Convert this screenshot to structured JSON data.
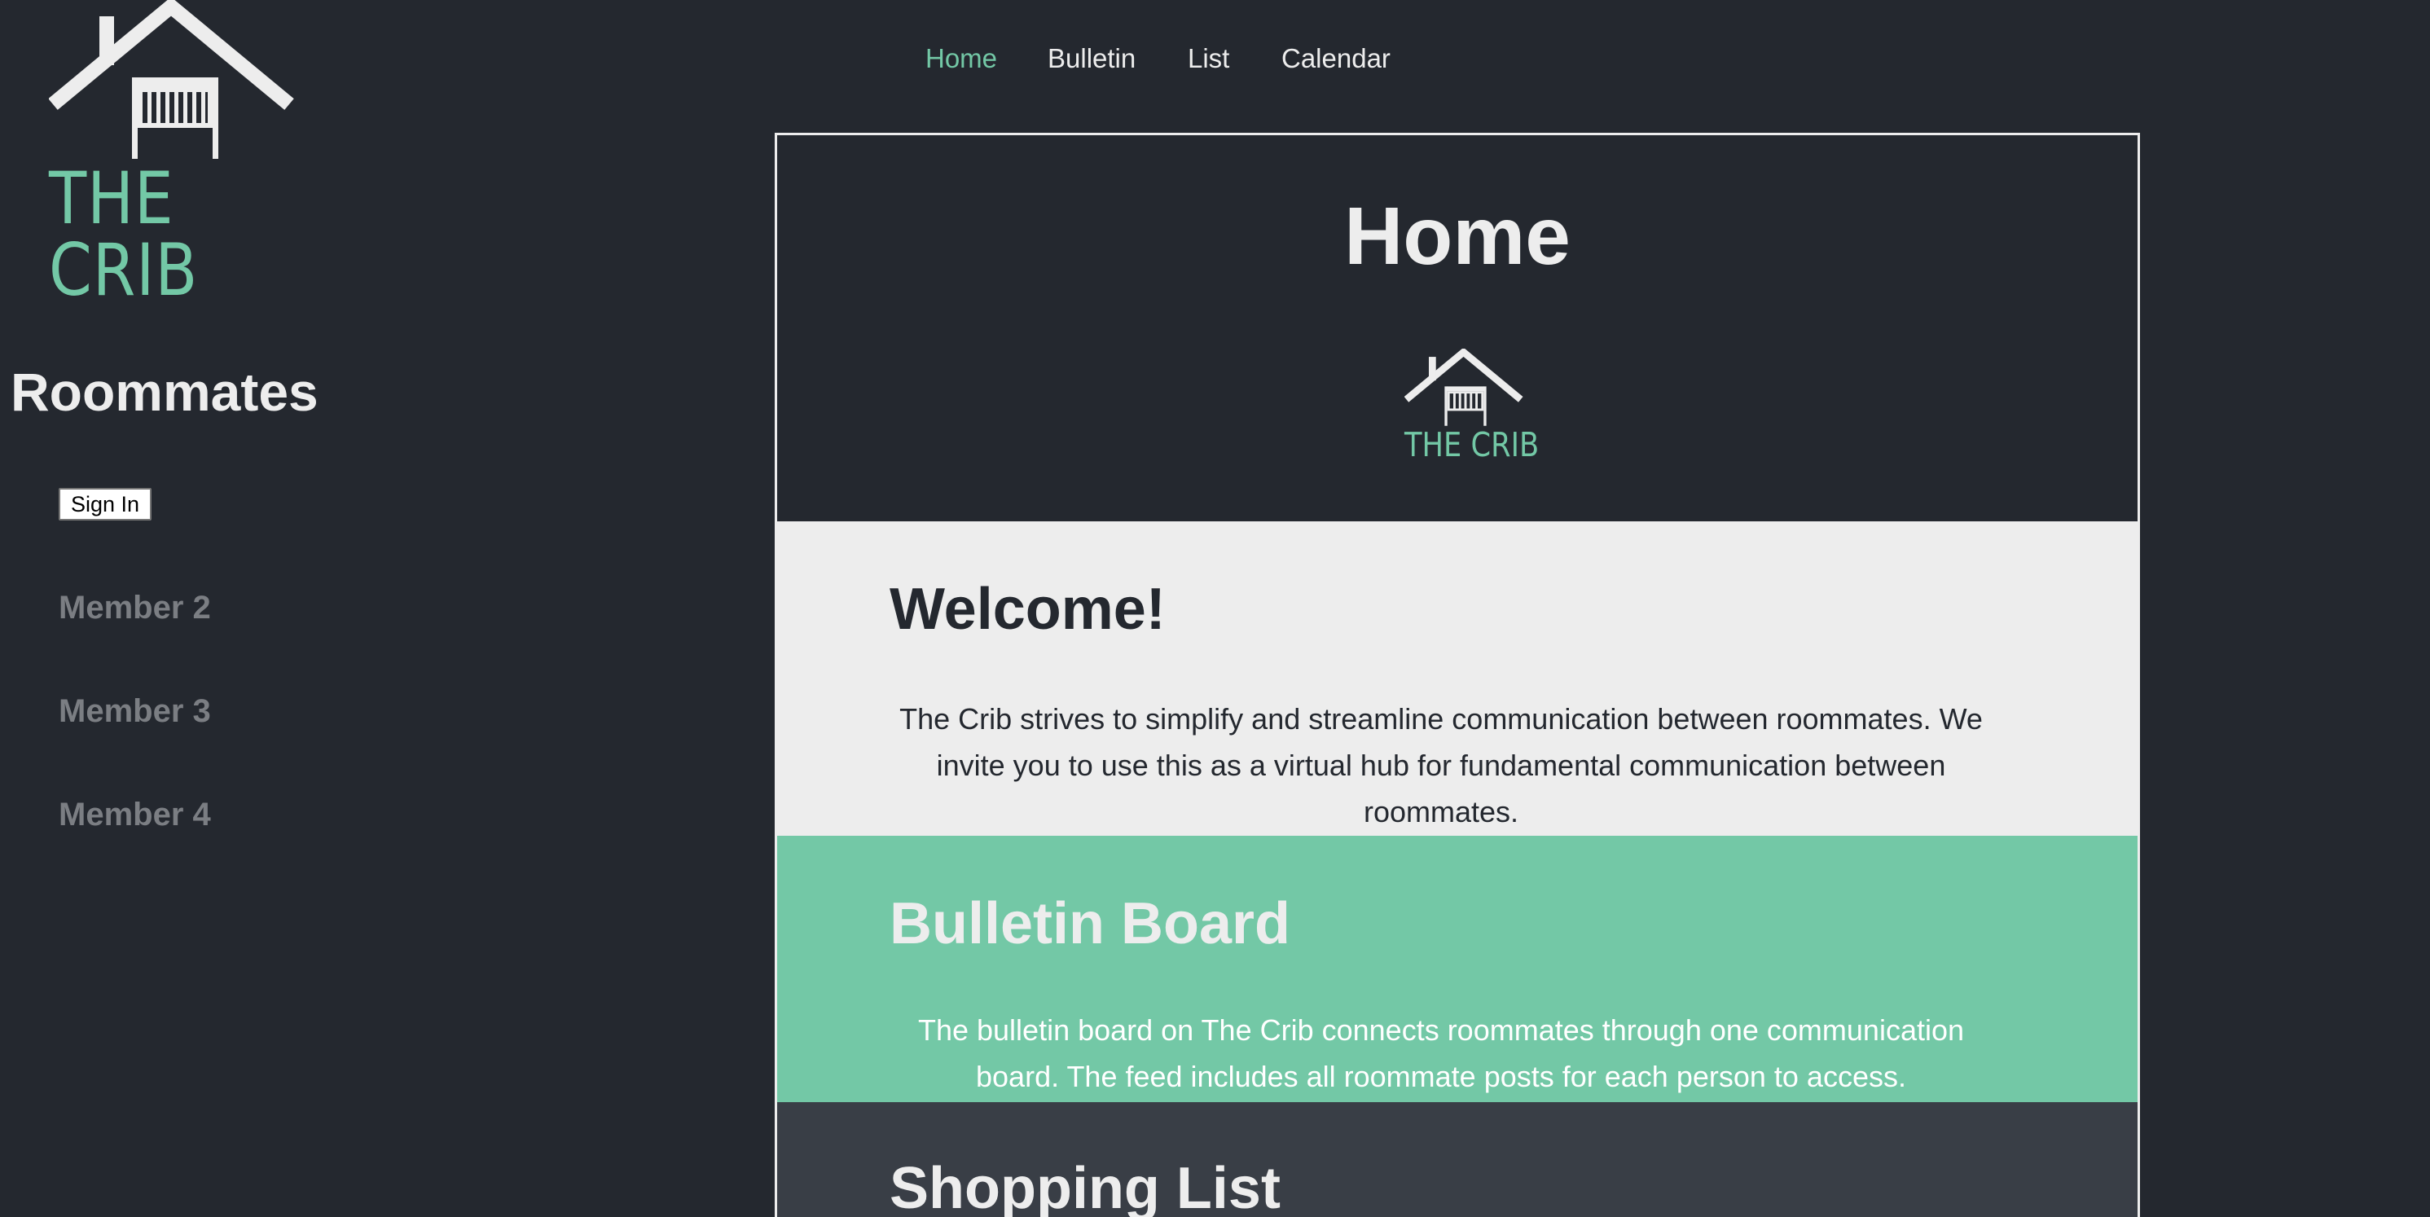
{
  "brand": {
    "name": "THE CRIB",
    "logo_icon": "house-crib-icon"
  },
  "sidebar": {
    "title": "Roommates",
    "sign_in_label": "Sign In",
    "members": [
      "Member 2",
      "Member 3",
      "Member 4"
    ]
  },
  "nav": {
    "items": [
      "Home",
      "Bulletin",
      "List",
      "Calendar"
    ],
    "active": "Home"
  },
  "hero": {
    "title": "Home",
    "logo_name": "THE CRIB"
  },
  "sections": {
    "welcome": {
      "title": "Welcome!",
      "text": "The Crib strives to simplify and streamline communication between roommates. We invite you to use this as a virtual hub for fundamental communication between roommates."
    },
    "bulletin": {
      "title": "Bulletin Board",
      "text": "The bulletin board on The Crib connects roommates through one communication board. The feed includes all roommate posts for each person to access."
    },
    "shopping": {
      "title": "Shopping List"
    }
  },
  "colors": {
    "background": "#24282f",
    "accent": "#73c8a6",
    "light": "#ededed",
    "muted": "#7b7e83",
    "section_dark": "#393e46"
  }
}
